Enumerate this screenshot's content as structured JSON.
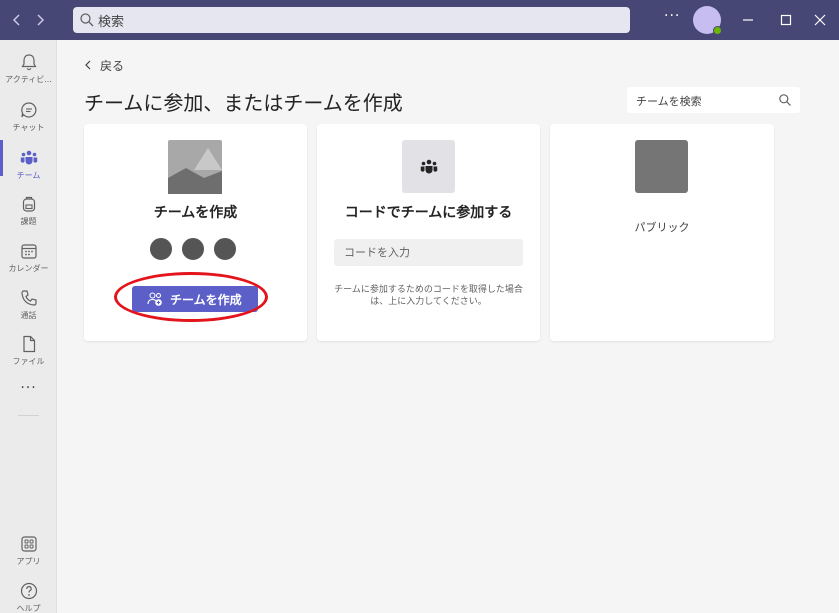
{
  "titlebar": {
    "search_placeholder": "検索",
    "more_label": "···"
  },
  "sidebar": {
    "items": [
      {
        "label": "アクティビ..."
      },
      {
        "label": "チャット"
      },
      {
        "label": "チーム"
      },
      {
        "label": "課題"
      },
      {
        "label": "カレンダー"
      },
      {
        "label": "通話"
      },
      {
        "label": "ファイル"
      }
    ],
    "more_label": "···",
    "bottom_items": [
      {
        "label": "アプリ"
      },
      {
        "label": "ヘルプ"
      }
    ],
    "active_index": 2
  },
  "main": {
    "back_label": "戻る",
    "page_title": "チームに参加、またはチームを作成",
    "team_search_placeholder": "チームを検索",
    "cards": {
      "create": {
        "title": "チームを作成",
        "button_label": "チームを作成"
      },
      "join_code": {
        "title": "コードでチームに参加する",
        "input_placeholder": "コードを入力",
        "description": "チームに参加するためのコードを取得した場合は、上に入力してください。"
      },
      "public": {
        "label": "パブリック"
      }
    }
  },
  "colors": {
    "titlebar": "#464775",
    "accent": "#5b5fc7",
    "highlight_ring": "#e3141c"
  }
}
